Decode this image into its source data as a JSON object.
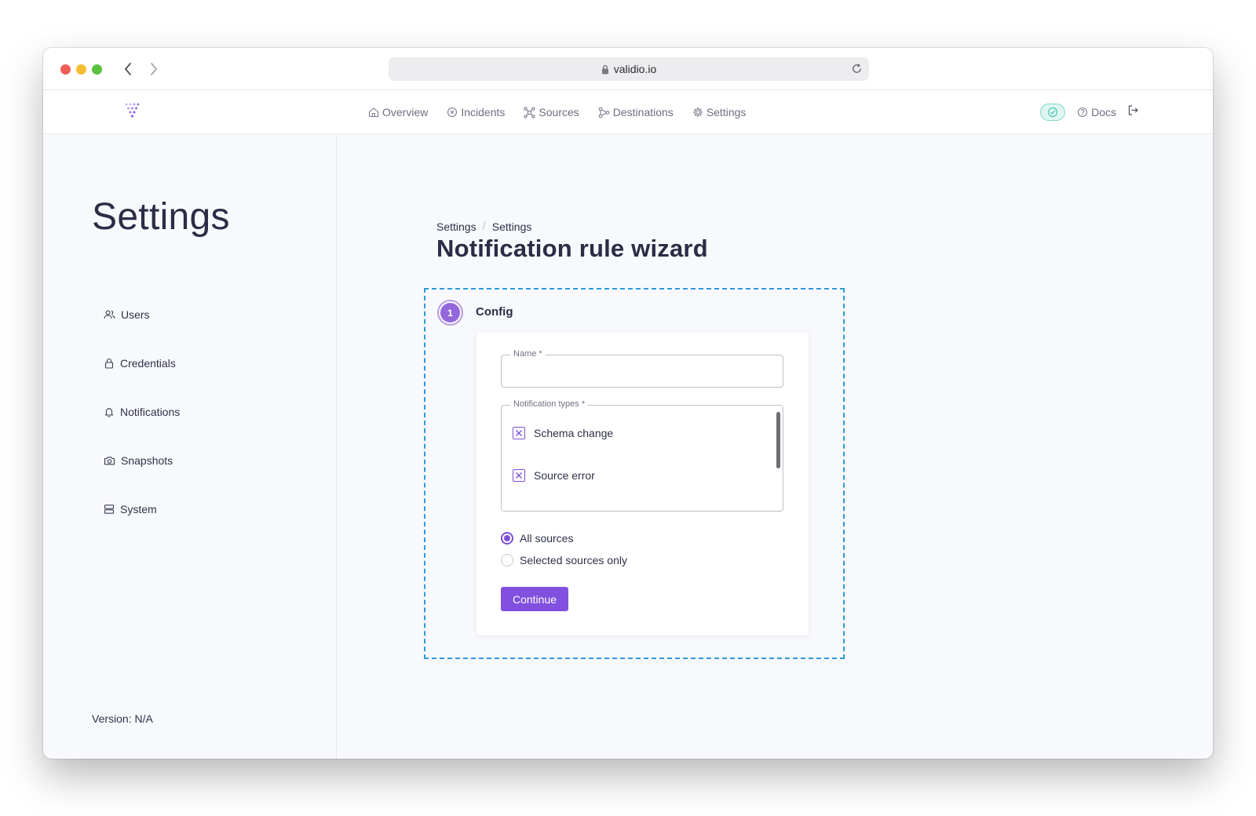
{
  "browser": {
    "url": "validio.io"
  },
  "topnav": {
    "items": [
      {
        "label": "Overview",
        "icon": "home-icon"
      },
      {
        "label": "Incidents",
        "icon": "x-circle-icon"
      },
      {
        "label": "Sources",
        "icon": "network-icon"
      },
      {
        "label": "Destinations",
        "icon": "share-icon"
      },
      {
        "label": "Settings",
        "icon": "gear-icon"
      }
    ],
    "docs_label": "Docs"
  },
  "sidebar": {
    "title": "Settings",
    "items": [
      {
        "label": "Users",
        "icon": "users-icon"
      },
      {
        "label": "Credentials",
        "icon": "lock-icon"
      },
      {
        "label": "Notifications",
        "icon": "bell-icon"
      },
      {
        "label": "Snapshots",
        "icon": "camera-icon"
      },
      {
        "label": "System",
        "icon": "server-icon"
      }
    ],
    "version": "Version: N/A"
  },
  "main": {
    "breadcrumb": [
      "Settings",
      "Settings"
    ],
    "title": "Notification rule wizard",
    "wizard": {
      "step_number": "1",
      "step_label": "Config",
      "name_field": {
        "legend": "Name *",
        "value": ""
      },
      "types_field": {
        "legend": "Notification types *",
        "options": [
          {
            "label": "Schema change",
            "checked": true
          },
          {
            "label": "Source error",
            "checked": true
          }
        ]
      },
      "source_scope": {
        "options": [
          {
            "label": "All sources",
            "selected": true
          },
          {
            "label": "Selected sources only",
            "selected": false
          }
        ]
      },
      "continue_label": "Continue"
    }
  },
  "colors": {
    "accent": "#8150df",
    "wizard_border": "#2d9ad9",
    "status_ok": "#4fc8b0"
  }
}
